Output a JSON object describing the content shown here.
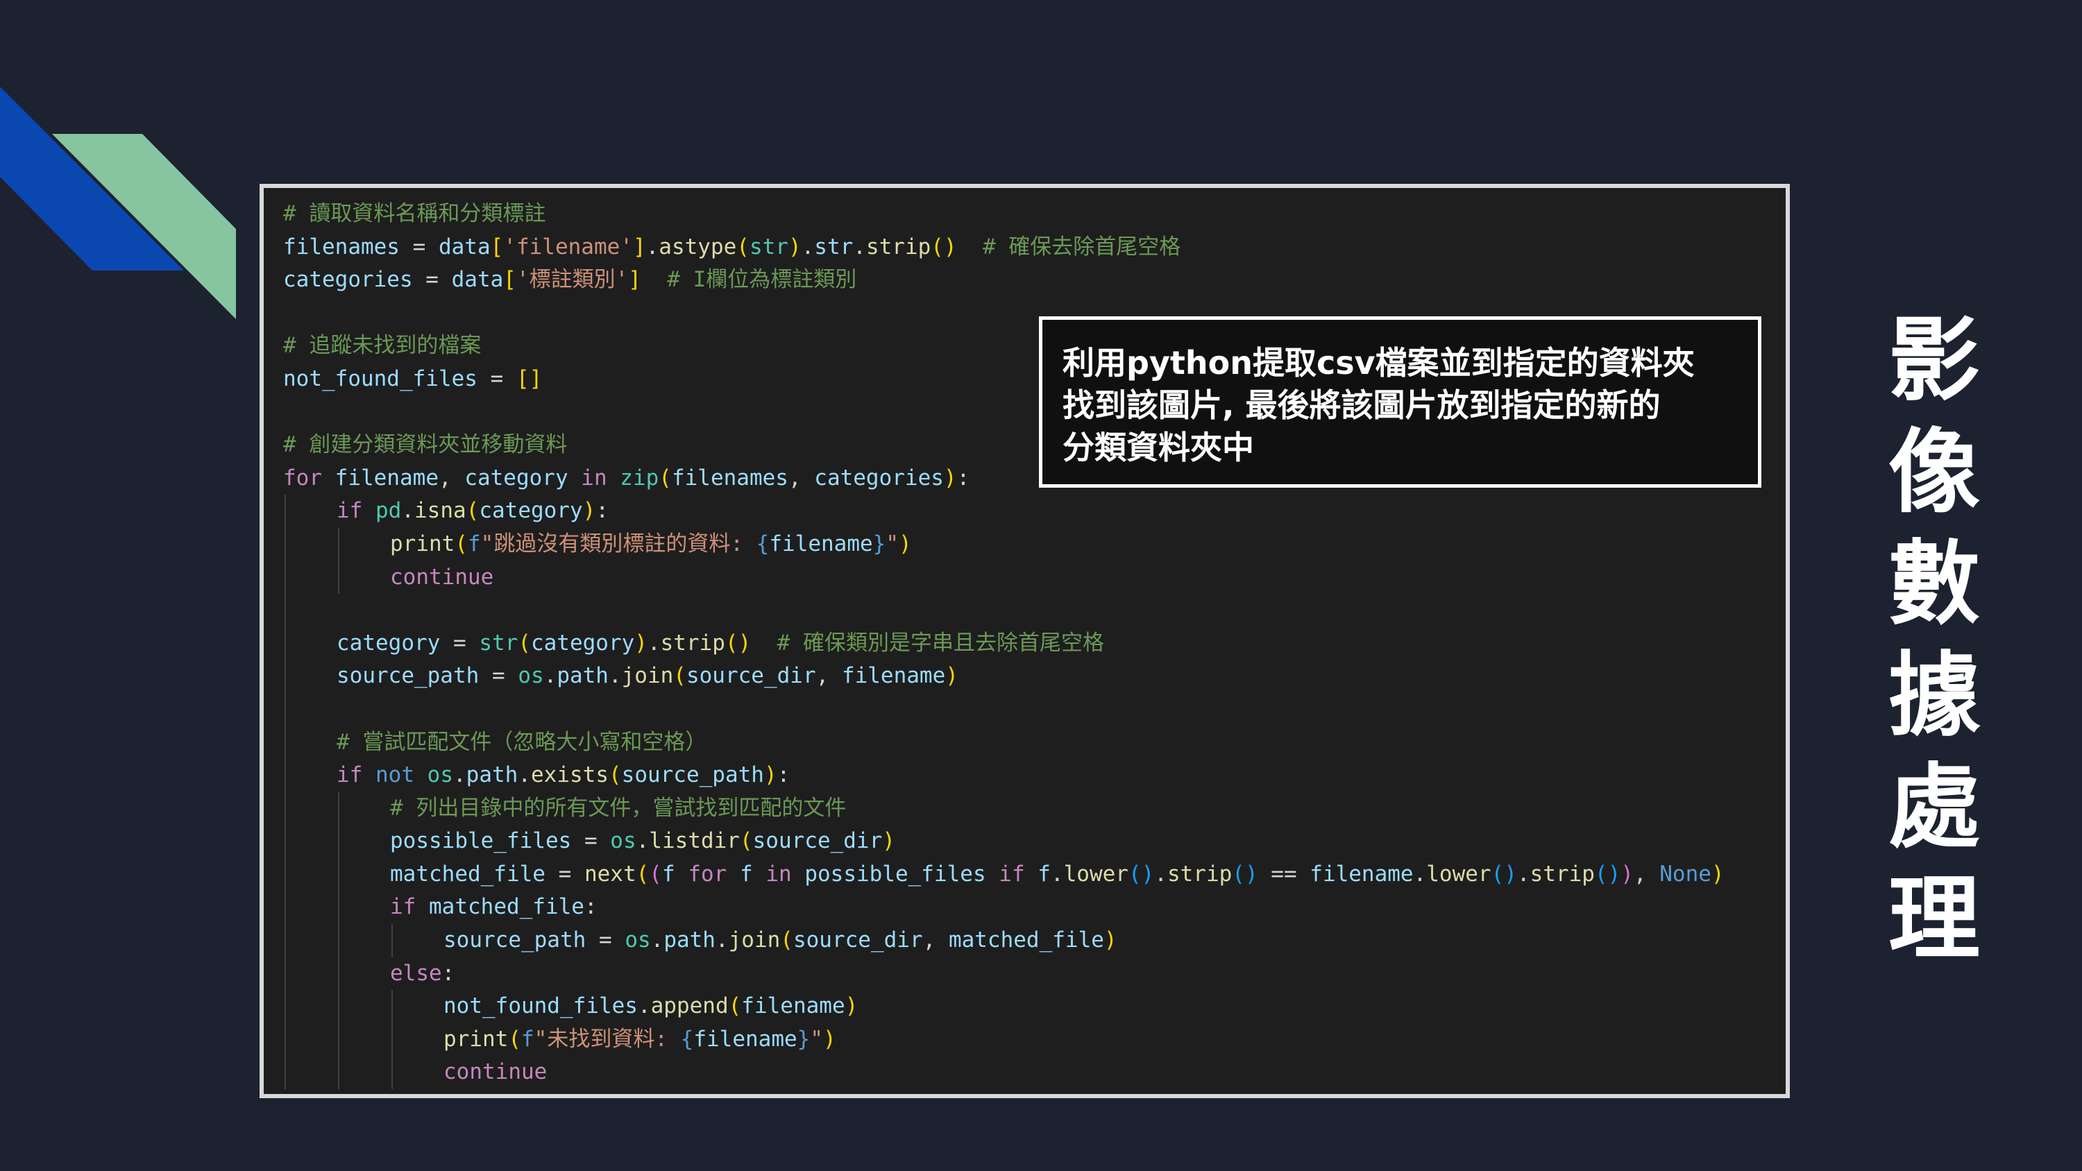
{
  "colors": {
    "background": "#1c2230",
    "deco_blue": "#0b47b0",
    "deco_green": "#86c5a0",
    "panel_border": "#d9d9d9",
    "code_bg": "#1e1e1e",
    "callout_border": "#ffffff"
  },
  "slide": {
    "title_chars": [
      "影",
      "像",
      "數",
      "據",
      "處",
      "理"
    ]
  },
  "callout": {
    "lines": [
      "利用python提取csv檔案並到指定的資料夾",
      "找到該圖片, 最後將該圖片放到指定的新的",
      "分類資料夾中"
    ]
  },
  "code": {
    "lines": [
      {
        "indent": 0,
        "tokens": [
          [
            "cm",
            "# 讀取資料名稱和分類標註"
          ]
        ]
      },
      {
        "indent": 0,
        "tokens": [
          [
            "vr",
            "filenames"
          ],
          [
            "op",
            " = "
          ],
          [
            "vr",
            "data"
          ],
          [
            "b1",
            "["
          ],
          [
            "st",
            "'filename'"
          ],
          [
            "b1",
            "]"
          ],
          [
            "op",
            "."
          ],
          [
            "fn",
            "astype"
          ],
          [
            "b1",
            "("
          ],
          [
            "ty",
            "str"
          ],
          [
            "b1",
            ")"
          ],
          [
            "op",
            "."
          ],
          [
            "vr",
            "str"
          ],
          [
            "op",
            "."
          ],
          [
            "fn",
            "strip"
          ],
          [
            "b1",
            "()"
          ],
          [
            "op",
            "  "
          ],
          [
            "cm",
            "# 確保去除首尾空格"
          ]
        ]
      },
      {
        "indent": 0,
        "tokens": [
          [
            "vr",
            "categories"
          ],
          [
            "op",
            " = "
          ],
          [
            "vr",
            "data"
          ],
          [
            "b1",
            "["
          ],
          [
            "st",
            "'標註類別'"
          ],
          [
            "b1",
            "]"
          ],
          [
            "op",
            "  "
          ],
          [
            "cm",
            "# I欄位為標註類別"
          ]
        ]
      },
      {
        "indent": 0,
        "tokens": []
      },
      {
        "indent": 0,
        "tokens": [
          [
            "cm",
            "# 追蹤未找到的檔案"
          ]
        ]
      },
      {
        "indent": 0,
        "tokens": [
          [
            "vr",
            "not_found_files"
          ],
          [
            "op",
            " = "
          ],
          [
            "b1",
            "[]"
          ]
        ]
      },
      {
        "indent": 0,
        "tokens": []
      },
      {
        "indent": 0,
        "tokens": [
          [
            "cm",
            "# 創建分類資料夾並移動資料"
          ]
        ]
      },
      {
        "indent": 0,
        "tokens": [
          [
            "kw",
            "for"
          ],
          [
            "op",
            " "
          ],
          [
            "vr",
            "filename"
          ],
          [
            "op",
            ", "
          ],
          [
            "vr",
            "category"
          ],
          [
            "op",
            " "
          ],
          [
            "kw",
            "in"
          ],
          [
            "op",
            " "
          ],
          [
            "ty",
            "zip"
          ],
          [
            "b1",
            "("
          ],
          [
            "vr",
            "filenames"
          ],
          [
            "op",
            ", "
          ],
          [
            "vr",
            "categories"
          ],
          [
            "b1",
            ")"
          ],
          [
            "op",
            ":"
          ]
        ]
      },
      {
        "indent": 1,
        "tokens": [
          [
            "kw",
            "if"
          ],
          [
            "op",
            " "
          ],
          [
            "ty",
            "pd"
          ],
          [
            "op",
            "."
          ],
          [
            "fn",
            "isna"
          ],
          [
            "b1",
            "("
          ],
          [
            "vr",
            "category"
          ],
          [
            "b1",
            ")"
          ],
          [
            "op",
            ":"
          ]
        ]
      },
      {
        "indent": 2,
        "tokens": [
          [
            "fn",
            "print"
          ],
          [
            "b1",
            "("
          ],
          [
            "bk",
            "f"
          ],
          [
            "st",
            "\"跳過沒有類別標註的資料: "
          ],
          [
            "bk",
            "{"
          ],
          [
            "vr",
            "filename"
          ],
          [
            "bk",
            "}"
          ],
          [
            "st",
            "\""
          ],
          [
            "b1",
            ")"
          ]
        ]
      },
      {
        "indent": 2,
        "tokens": [
          [
            "kw",
            "continue"
          ]
        ]
      },
      {
        "indent": 1,
        "tokens": []
      },
      {
        "indent": 1,
        "tokens": [
          [
            "vr",
            "category"
          ],
          [
            "op",
            " = "
          ],
          [
            "ty",
            "str"
          ],
          [
            "b1",
            "("
          ],
          [
            "vr",
            "category"
          ],
          [
            "b1",
            ")"
          ],
          [
            "op",
            "."
          ],
          [
            "fn",
            "strip"
          ],
          [
            "b1",
            "()"
          ],
          [
            "op",
            "  "
          ],
          [
            "cm",
            "# 確保類別是字串且去除首尾空格"
          ]
        ]
      },
      {
        "indent": 1,
        "tokens": [
          [
            "vr",
            "source_path"
          ],
          [
            "op",
            " = "
          ],
          [
            "ty",
            "os"
          ],
          [
            "op",
            "."
          ],
          [
            "vr",
            "path"
          ],
          [
            "op",
            "."
          ],
          [
            "fn",
            "join"
          ],
          [
            "b1",
            "("
          ],
          [
            "vr",
            "source_dir"
          ],
          [
            "op",
            ", "
          ],
          [
            "vr",
            "filename"
          ],
          [
            "b1",
            ")"
          ]
        ]
      },
      {
        "indent": 1,
        "tokens": []
      },
      {
        "indent": 1,
        "tokens": [
          [
            "cm",
            "# 嘗試匹配文件（忽略大小寫和空格）"
          ]
        ]
      },
      {
        "indent": 1,
        "tokens": [
          [
            "kw",
            "if"
          ],
          [
            "op",
            " "
          ],
          [
            "bk",
            "not"
          ],
          [
            "op",
            " "
          ],
          [
            "ty",
            "os"
          ],
          [
            "op",
            "."
          ],
          [
            "vr",
            "path"
          ],
          [
            "op",
            "."
          ],
          [
            "fn",
            "exists"
          ],
          [
            "b1",
            "("
          ],
          [
            "vr",
            "source_path"
          ],
          [
            "b1",
            ")"
          ],
          [
            "op",
            ":"
          ]
        ]
      },
      {
        "indent": 2,
        "tokens": [
          [
            "cm",
            "# 列出目錄中的所有文件，嘗試找到匹配的文件"
          ]
        ]
      },
      {
        "indent": 2,
        "tokens": [
          [
            "vr",
            "possible_files"
          ],
          [
            "op",
            " = "
          ],
          [
            "ty",
            "os"
          ],
          [
            "op",
            "."
          ],
          [
            "fn",
            "listdir"
          ],
          [
            "b1",
            "("
          ],
          [
            "vr",
            "source_dir"
          ],
          [
            "b1",
            ")"
          ]
        ]
      },
      {
        "indent": 2,
        "tokens": [
          [
            "vr",
            "matched_file"
          ],
          [
            "op",
            " = "
          ],
          [
            "fn",
            "next"
          ],
          [
            "b1",
            "("
          ],
          [
            "b2",
            "("
          ],
          [
            "vr",
            "f"
          ],
          [
            "op",
            " "
          ],
          [
            "kw",
            "for"
          ],
          [
            "op",
            " "
          ],
          [
            "vr",
            "f"
          ],
          [
            "op",
            " "
          ],
          [
            "kw",
            "in"
          ],
          [
            "op",
            " "
          ],
          [
            "vr",
            "possible_files"
          ],
          [
            "op",
            " "
          ],
          [
            "kw",
            "if"
          ],
          [
            "op",
            " "
          ],
          [
            "vr",
            "f"
          ],
          [
            "op",
            "."
          ],
          [
            "fn",
            "lower"
          ],
          [
            "b3",
            "()"
          ],
          [
            "op",
            "."
          ],
          [
            "fn",
            "strip"
          ],
          [
            "b3",
            "()"
          ],
          [
            "op",
            " == "
          ],
          [
            "vr",
            "filename"
          ],
          [
            "op",
            "."
          ],
          [
            "fn",
            "lower"
          ],
          [
            "b3",
            "()"
          ],
          [
            "op",
            "."
          ],
          [
            "fn",
            "strip"
          ],
          [
            "b3",
            "()"
          ],
          [
            "b2",
            ")"
          ],
          [
            "op",
            ", "
          ],
          [
            "bk",
            "None"
          ],
          [
            "b1",
            ")"
          ]
        ]
      },
      {
        "indent": 2,
        "tokens": [
          [
            "kw",
            "if"
          ],
          [
            "op",
            " "
          ],
          [
            "vr",
            "matched_file"
          ],
          [
            "op",
            ":"
          ]
        ]
      },
      {
        "indent": 3,
        "tokens": [
          [
            "vr",
            "source_path"
          ],
          [
            "op",
            " = "
          ],
          [
            "ty",
            "os"
          ],
          [
            "op",
            "."
          ],
          [
            "vr",
            "path"
          ],
          [
            "op",
            "."
          ],
          [
            "fn",
            "join"
          ],
          [
            "b1",
            "("
          ],
          [
            "vr",
            "source_dir"
          ],
          [
            "op",
            ", "
          ],
          [
            "vr",
            "matched_file"
          ],
          [
            "b1",
            ")"
          ]
        ]
      },
      {
        "indent": 2,
        "tokens": [
          [
            "kw",
            "else"
          ],
          [
            "op",
            ":"
          ]
        ]
      },
      {
        "indent": 3,
        "tokens": [
          [
            "vr",
            "not_found_files"
          ],
          [
            "op",
            "."
          ],
          [
            "fn",
            "append"
          ],
          [
            "b1",
            "("
          ],
          [
            "vr",
            "filename"
          ],
          [
            "b1",
            ")"
          ]
        ]
      },
      {
        "indent": 3,
        "tokens": [
          [
            "fn",
            "print"
          ],
          [
            "b1",
            "("
          ],
          [
            "bk",
            "f"
          ],
          [
            "st",
            "\"未找到資料: "
          ],
          [
            "bk",
            "{"
          ],
          [
            "vr",
            "filename"
          ],
          [
            "bk",
            "}"
          ],
          [
            "st",
            "\""
          ],
          [
            "b1",
            ")"
          ]
        ]
      },
      {
        "indent": 3,
        "tokens": [
          [
            "kw",
            "continue"
          ]
        ]
      }
    ]
  }
}
